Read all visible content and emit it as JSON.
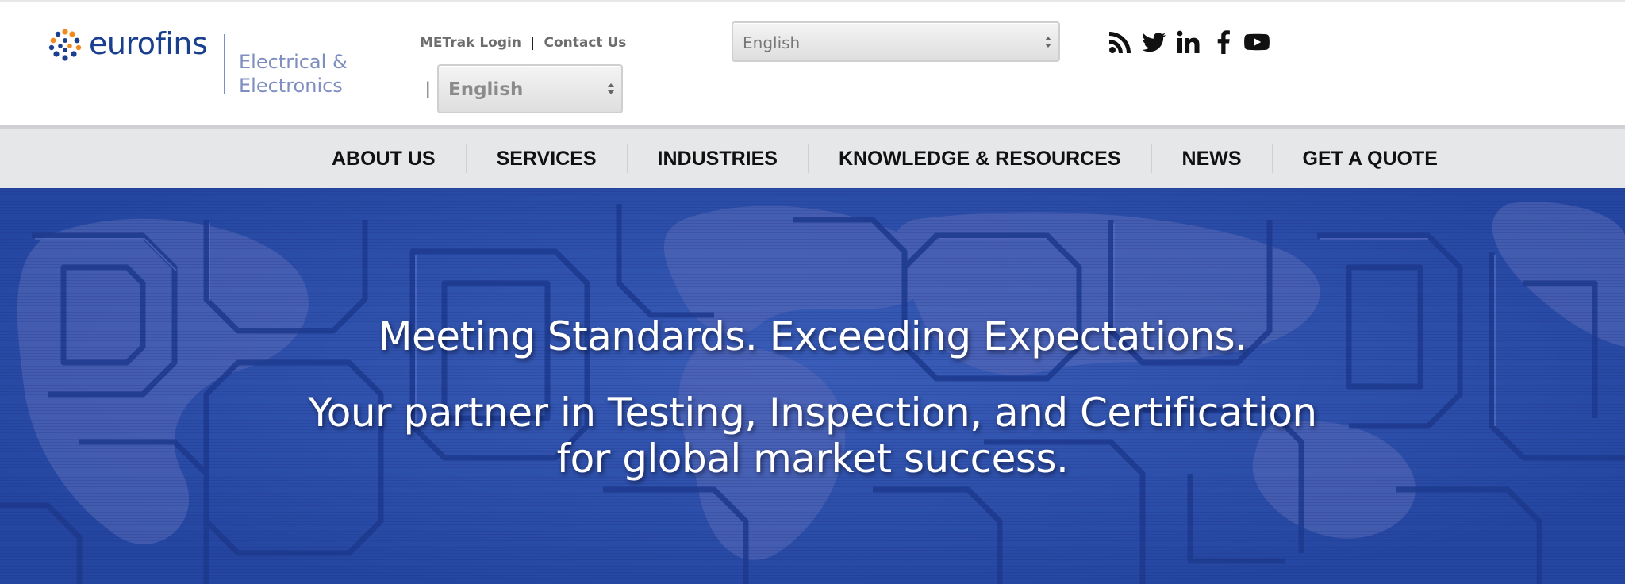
{
  "header": {
    "brand_name": "eurofins",
    "division_line1": "Electrical &",
    "division_line2": "Electronics",
    "links": {
      "metrak_login": "METrak Login",
      "separator": "|",
      "contact_us": "Contact Us"
    },
    "language_select_top": {
      "selected": "English"
    },
    "language_select_small": {
      "selected": "English",
      "leading_separator": "|"
    },
    "social_icons": [
      "rss-icon",
      "twitter-icon",
      "linkedin-icon",
      "facebook-icon",
      "youtube-icon"
    ]
  },
  "nav": {
    "items": [
      "ABOUT US",
      "SERVICES",
      "INDUSTRIES",
      "KNOWLEDGE & RESOURCES",
      "NEWS",
      "GET A QUOTE"
    ]
  },
  "hero": {
    "headline": "Meeting Standards. Exceeding Expectations.",
    "subheadline": "Your partner in Testing, Inspection, and Certification for global market success."
  },
  "colors": {
    "brand_blue": "#1b3f8f",
    "division_gray_blue": "#7f8ec0",
    "nav_background": "#e6e7e9",
    "hero_blue": "#2a4fa8"
  }
}
